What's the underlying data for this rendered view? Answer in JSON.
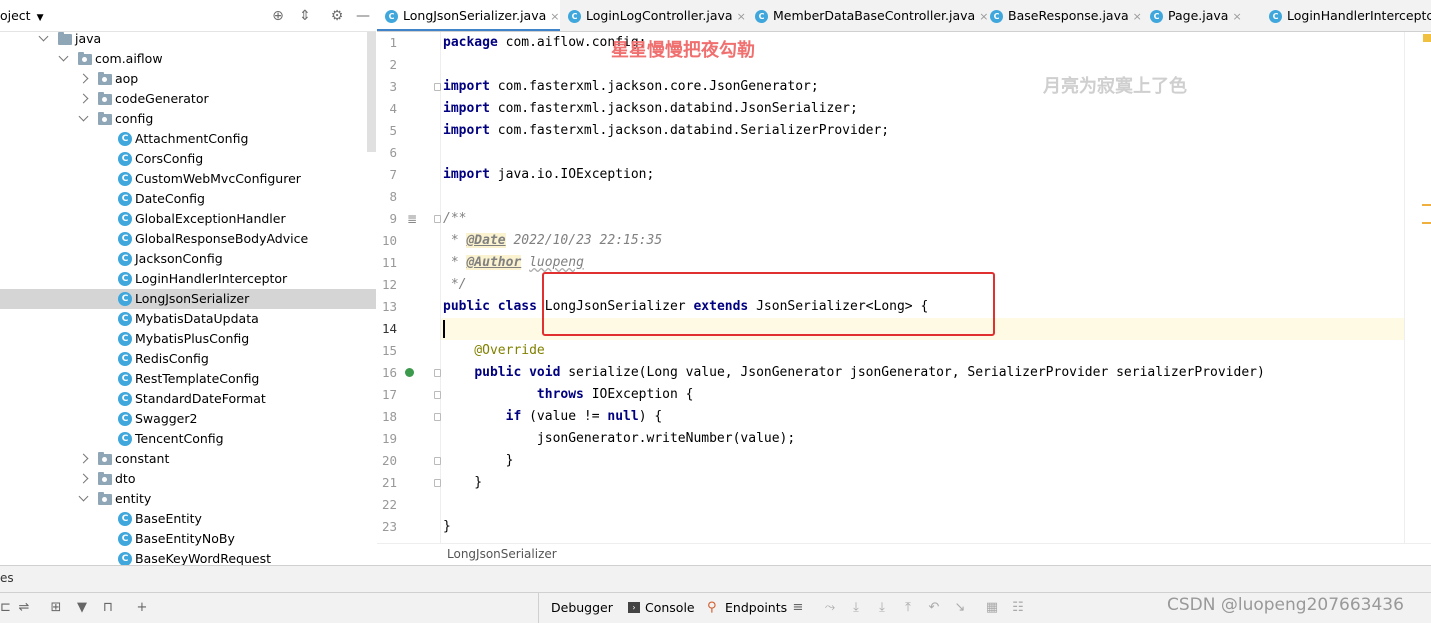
{
  "project_panel": {
    "title": "oject",
    "icons": [
      "target-icon",
      "collapse-icon",
      "gear-icon",
      "minimize-icon"
    ]
  },
  "tree": [
    {
      "label": "java",
      "type": "folder",
      "expanded": true
    },
    {
      "label": "com.aiflow",
      "type": "package",
      "expanded": true
    },
    {
      "label": "aop",
      "type": "package",
      "expanded": false
    },
    {
      "label": "codeGenerator",
      "type": "package",
      "expanded": false
    },
    {
      "label": "config",
      "type": "package",
      "expanded": true
    },
    {
      "label": "AttachmentConfig",
      "type": "class"
    },
    {
      "label": "CorsConfig",
      "type": "class"
    },
    {
      "label": "CustomWebMvcConfigurer",
      "type": "class"
    },
    {
      "label": "DateConfig",
      "type": "class"
    },
    {
      "label": "GlobalExceptionHandler",
      "type": "class"
    },
    {
      "label": "GlobalResponseBodyAdvice",
      "type": "class"
    },
    {
      "label": "JacksonConfig",
      "type": "class"
    },
    {
      "label": "LoginHandlerInterceptor",
      "type": "class"
    },
    {
      "label": "LongJsonSerializer",
      "type": "class",
      "selected": true
    },
    {
      "label": "MybatisDataUpdata",
      "type": "class"
    },
    {
      "label": "MybatisPlusConfig",
      "type": "class"
    },
    {
      "label": "RedisConfig",
      "type": "class"
    },
    {
      "label": "RestTemplateConfig",
      "type": "class"
    },
    {
      "label": "StandardDateFormat",
      "type": "class"
    },
    {
      "label": "Swagger2",
      "type": "class"
    },
    {
      "label": "TencentConfig",
      "type": "class"
    },
    {
      "label": "constant",
      "type": "package",
      "expanded": false
    },
    {
      "label": "dto",
      "type": "package",
      "expanded": false
    },
    {
      "label": "entity",
      "type": "package",
      "expanded": true
    },
    {
      "label": "BaseEntity",
      "type": "class"
    },
    {
      "label": "BaseEntityNoBy",
      "type": "class"
    },
    {
      "label": "BaseKeyWordRequest",
      "type": "class"
    }
  ],
  "tabs": [
    {
      "label": "LongJsonSerializer.java",
      "active": true
    },
    {
      "label": "LoginLogController.java"
    },
    {
      "label": "MemberDataBaseController.java"
    },
    {
      "label": "BaseResponse.java"
    },
    {
      "label": "Page.java"
    },
    {
      "label": "LoginHandlerInterceptc"
    }
  ],
  "code": {
    "line_numbers": [
      "1",
      "2",
      "3",
      "4",
      "5",
      "6",
      "7",
      "8",
      "9",
      "10",
      "11",
      "12",
      "13",
      "14",
      "15",
      "16",
      "17",
      "18",
      "19",
      "20",
      "21",
      "22",
      "23"
    ],
    "current_line": 14
  },
  "watermarks": {
    "top": "星星慢慢把夜勾勒",
    "right": "月亮为寂寞上了色"
  },
  "breadcrumb": "LongJsonSerializer",
  "split_label": "es",
  "bottom_tabs": [
    "Debugger",
    "Console",
    "Endpoints"
  ],
  "csdn_watermark": "CSDN @luopeng207663436",
  "colors": {
    "accent": "#4083c9",
    "highlight_box": "#e03030",
    "keyword": "#000080",
    "annotation": "#808000"
  }
}
